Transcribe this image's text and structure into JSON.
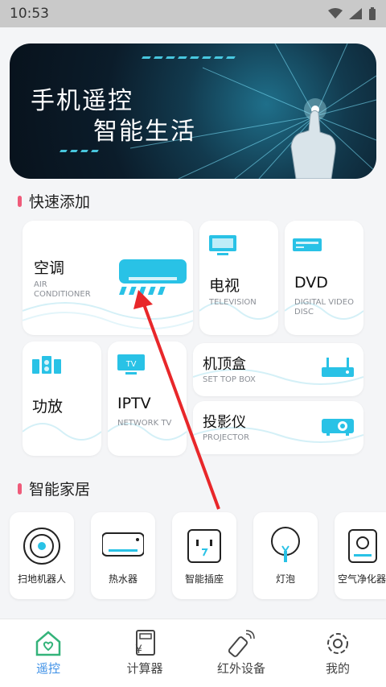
{
  "status_bar": {
    "time": "10:53",
    "icons": [
      "wifi-icon",
      "signal-icon",
      "battery-icon"
    ]
  },
  "banner": {
    "line1": "手机遥控",
    "line2": "智能生活"
  },
  "quick_add": {
    "title": "快速添加",
    "items": [
      {
        "name": "空调",
        "sub": "AIR\nCONDITIONER",
        "icon": "air-conditioner-icon"
      },
      {
        "name": "电视",
        "sub": "TELEVISION",
        "icon": "tv-icon"
      },
      {
        "name": "DVD",
        "sub": "DIGITAL VIDEO\nDISC",
        "icon": "dvd-icon"
      },
      {
        "name": "功放",
        "sub": "",
        "icon": "amplifier-icon"
      },
      {
        "name": "IPTV",
        "sub": "NETWORK TV",
        "icon": "iptv-icon"
      },
      {
        "name": "机顶盒",
        "sub": "SET TOP BOX",
        "icon": "set-top-box-icon"
      },
      {
        "name": "投影仪",
        "sub": "PROJECTOR",
        "icon": "projector-icon"
      }
    ]
  },
  "smart_home": {
    "title": "智能家居",
    "items": [
      {
        "label": "扫地机器人",
        "icon": "robot-vacuum-icon"
      },
      {
        "label": "热水器",
        "icon": "water-heater-icon"
      },
      {
        "label": "智能插座",
        "icon": "smart-socket-icon"
      },
      {
        "label": "灯泡",
        "icon": "light-bulb-icon"
      },
      {
        "label": "空气净化器",
        "icon": "air-purifier-icon"
      }
    ]
  },
  "tabs": [
    {
      "label": "遥控",
      "icon": "remote-home-icon",
      "active": true
    },
    {
      "label": "计算器",
      "icon": "calculator-icon",
      "active": false
    },
    {
      "label": "红外设备",
      "icon": "infrared-remote-icon",
      "active": false
    },
    {
      "label": "我的",
      "icon": "settings-gear-icon",
      "active": false
    }
  ],
  "colors": {
    "accent": "#3a8ee6",
    "device_icon": "#29c2e6",
    "section_marker": "#ef5b7a",
    "annotation_arrow": "#e8272a"
  }
}
